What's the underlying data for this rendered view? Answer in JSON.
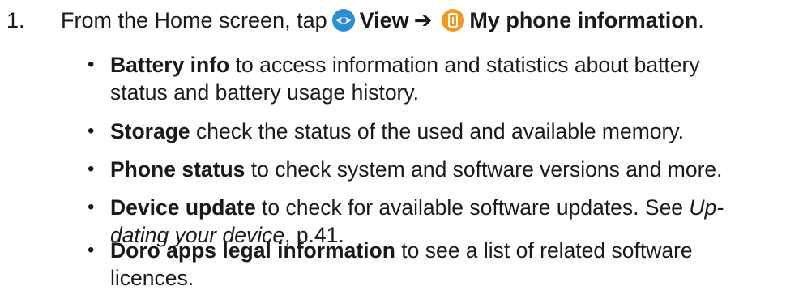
{
  "step": {
    "number": "1.",
    "intro": "From the Home screen, tap",
    "view_label": "View",
    "arrow": "➔",
    "target_label": "My phone information",
    "end": ".",
    "view_icon": "eye-icon",
    "info_icon": "phone-info-icon",
    "colors": {
      "view_icon": "#2b8fd6",
      "info_icon": "#f39a1e"
    }
  },
  "bullets": [
    {
      "term": "Battery info",
      "line1": " to access information and statistics about battery",
      "line2": "status and battery usage history."
    },
    {
      "term": "Storage",
      "line1": " check the status of the used and available memory."
    },
    {
      "term": "Phone status",
      "line1": " to check system and software versions and more."
    },
    {
      "term": "Device update",
      "line1": " to check for available software updates. See ",
      "link_part1": "Up-",
      "link_part2": "dating your device",
      "line2_rest": ", p.41."
    },
    {
      "term": "Doro apps legal information",
      "line1": " to see a list of related software",
      "line2": "licences."
    }
  ],
  "bullet_symbol": "•"
}
